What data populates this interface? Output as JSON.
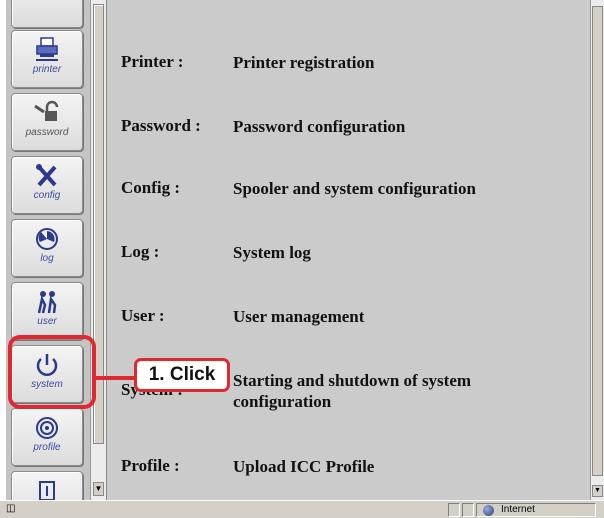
{
  "toolbar": {
    "buttons": [
      {
        "id": "printer",
        "label": "printer",
        "icon": "printer-icon"
      },
      {
        "id": "password",
        "label": "password",
        "icon": "key-icon"
      },
      {
        "id": "config",
        "label": "config",
        "icon": "tools-icon"
      },
      {
        "id": "log",
        "label": "log",
        "icon": "log-icon"
      },
      {
        "id": "user",
        "label": "user",
        "icon": "users-icon"
      },
      {
        "id": "system",
        "label": "system",
        "icon": "power-icon"
      },
      {
        "id": "profile",
        "label": "profile",
        "icon": "target-icon"
      }
    ]
  },
  "menu": [
    {
      "key": "Printer :",
      "desc": "Printer registration"
    },
    {
      "key": "Password :",
      "desc": "Password configuration"
    },
    {
      "key": "Config :",
      "desc": "Spooler and system configuration"
    },
    {
      "key": "Log :",
      "desc": "System log"
    },
    {
      "key": "User :",
      "desc": "User management"
    },
    {
      "key": "System :",
      "desc": "Starting and shutdown of system configuration"
    },
    {
      "key": "Profile :",
      "desc": "Upload ICC Profile"
    }
  ],
  "annotation": {
    "callout": "1. Click",
    "color": "#e02830"
  },
  "status": {
    "zone": "Internet"
  }
}
